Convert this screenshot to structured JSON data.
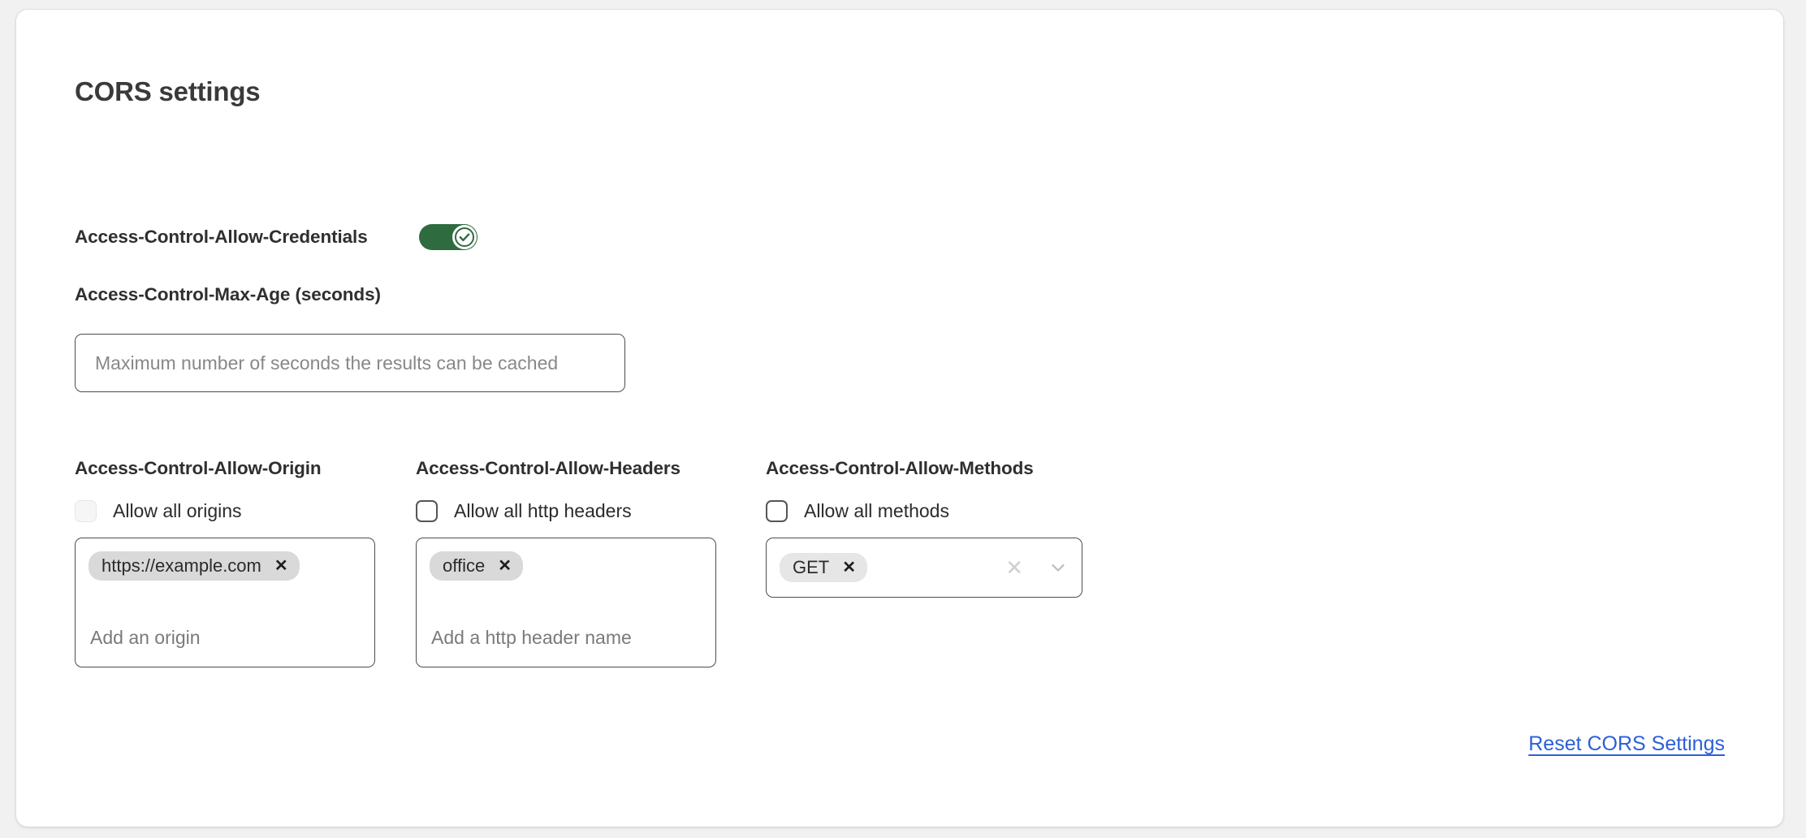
{
  "page": {
    "title": "CORS settings"
  },
  "credentials": {
    "label": "Access-Control-Allow-Credentials",
    "toggle_state": "on",
    "toggle_color": "#2e6b3f",
    "toggle_icon": "check-icon"
  },
  "max_age": {
    "label": "Access-Control-Max-Age (seconds)",
    "value": "",
    "placeholder": "Maximum number of seconds the results can be cached"
  },
  "columns": {
    "origin": {
      "title": "Access-Control-Allow-Origin",
      "checkbox_label": "Allow all origins",
      "checkbox_checked": false,
      "checkbox_style": "muted",
      "tags": [
        {
          "label": "https://example.com",
          "remove_icon": "close-icon"
        }
      ],
      "input_placeholder": "Add an origin"
    },
    "headers": {
      "title": "Access-Control-Allow-Headers",
      "checkbox_label": "Allow all http headers",
      "checkbox_checked": false,
      "checkbox_style": "outlined",
      "tags": [
        {
          "label": "office",
          "remove_icon": "close-icon"
        }
      ],
      "input_placeholder": "Add a http header name"
    },
    "methods": {
      "title": "Access-Control-Allow-Methods",
      "checkbox_label": "Allow all methods",
      "checkbox_checked": false,
      "checkbox_style": "outlined",
      "tags": [
        {
          "label": "GET",
          "remove_icon": "close-icon"
        }
      ],
      "clear_icon": "clear-all-icon",
      "dropdown_icon": "chevron-down-icon"
    }
  },
  "footer": {
    "reset_label": "Reset CORS Settings",
    "reset_color": "#2b5fd9"
  }
}
